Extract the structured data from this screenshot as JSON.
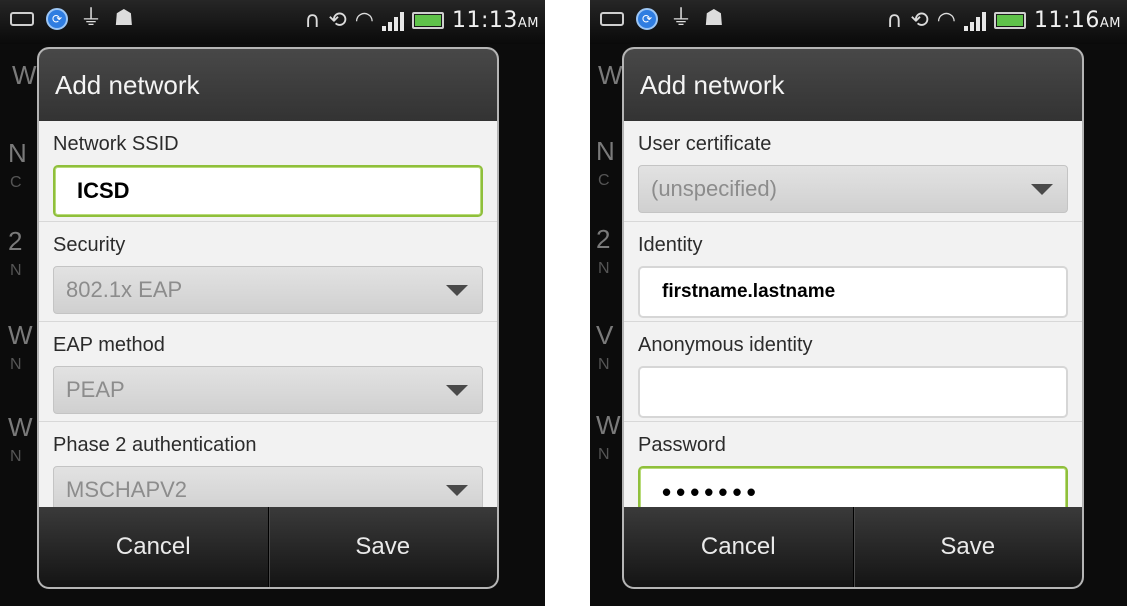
{
  "left_screen": {
    "statusbar": {
      "time": "11:13",
      "ampm": "AM",
      "battery_color": "#5fc24a"
    },
    "background": {
      "letters": [
        "W",
        "N",
        "C",
        "2",
        "N",
        "W",
        "N",
        "W",
        "N"
      ]
    },
    "dialog": {
      "title": "Add network",
      "fields": {
        "ssid": {
          "label": "Network SSID",
          "value": "ICSD"
        },
        "security": {
          "label": "Security",
          "value": "802.1x EAP"
        },
        "eap_method": {
          "label": "EAP method",
          "value": "PEAP"
        },
        "phase2": {
          "label": "Phase 2 authentication",
          "value": "MSCHAPV2"
        }
      },
      "buttons": {
        "cancel": "Cancel",
        "save": "Save"
      }
    }
  },
  "right_screen": {
    "statusbar": {
      "time": "11:16",
      "ampm": "AM",
      "battery_color": "#5fc24a"
    },
    "background": {
      "letters": [
        "W",
        "N",
        "C",
        "2",
        "N",
        "V",
        "N",
        "W",
        "N"
      ]
    },
    "dialog": {
      "title": "Add network",
      "fields": {
        "user_certificate": {
          "label": "User certificate",
          "value": "(unspecified)"
        },
        "identity": {
          "label": "Identity",
          "value": "firstname.lastname"
        },
        "anonymous_identity": {
          "label": "Anonymous identity",
          "value": ""
        },
        "password": {
          "label": "Password",
          "value": "•••••••"
        }
      },
      "buttons": {
        "cancel": "Cancel",
        "save": "Save"
      }
    }
  },
  "icons": [
    "keyboard-icon",
    "sync-icon",
    "usb-icon",
    "debug-icon",
    "headset-icon",
    "rotation-icon",
    "wifi-icon",
    "signal-icon",
    "battery-icon",
    "dropdown-caret-icon"
  ]
}
